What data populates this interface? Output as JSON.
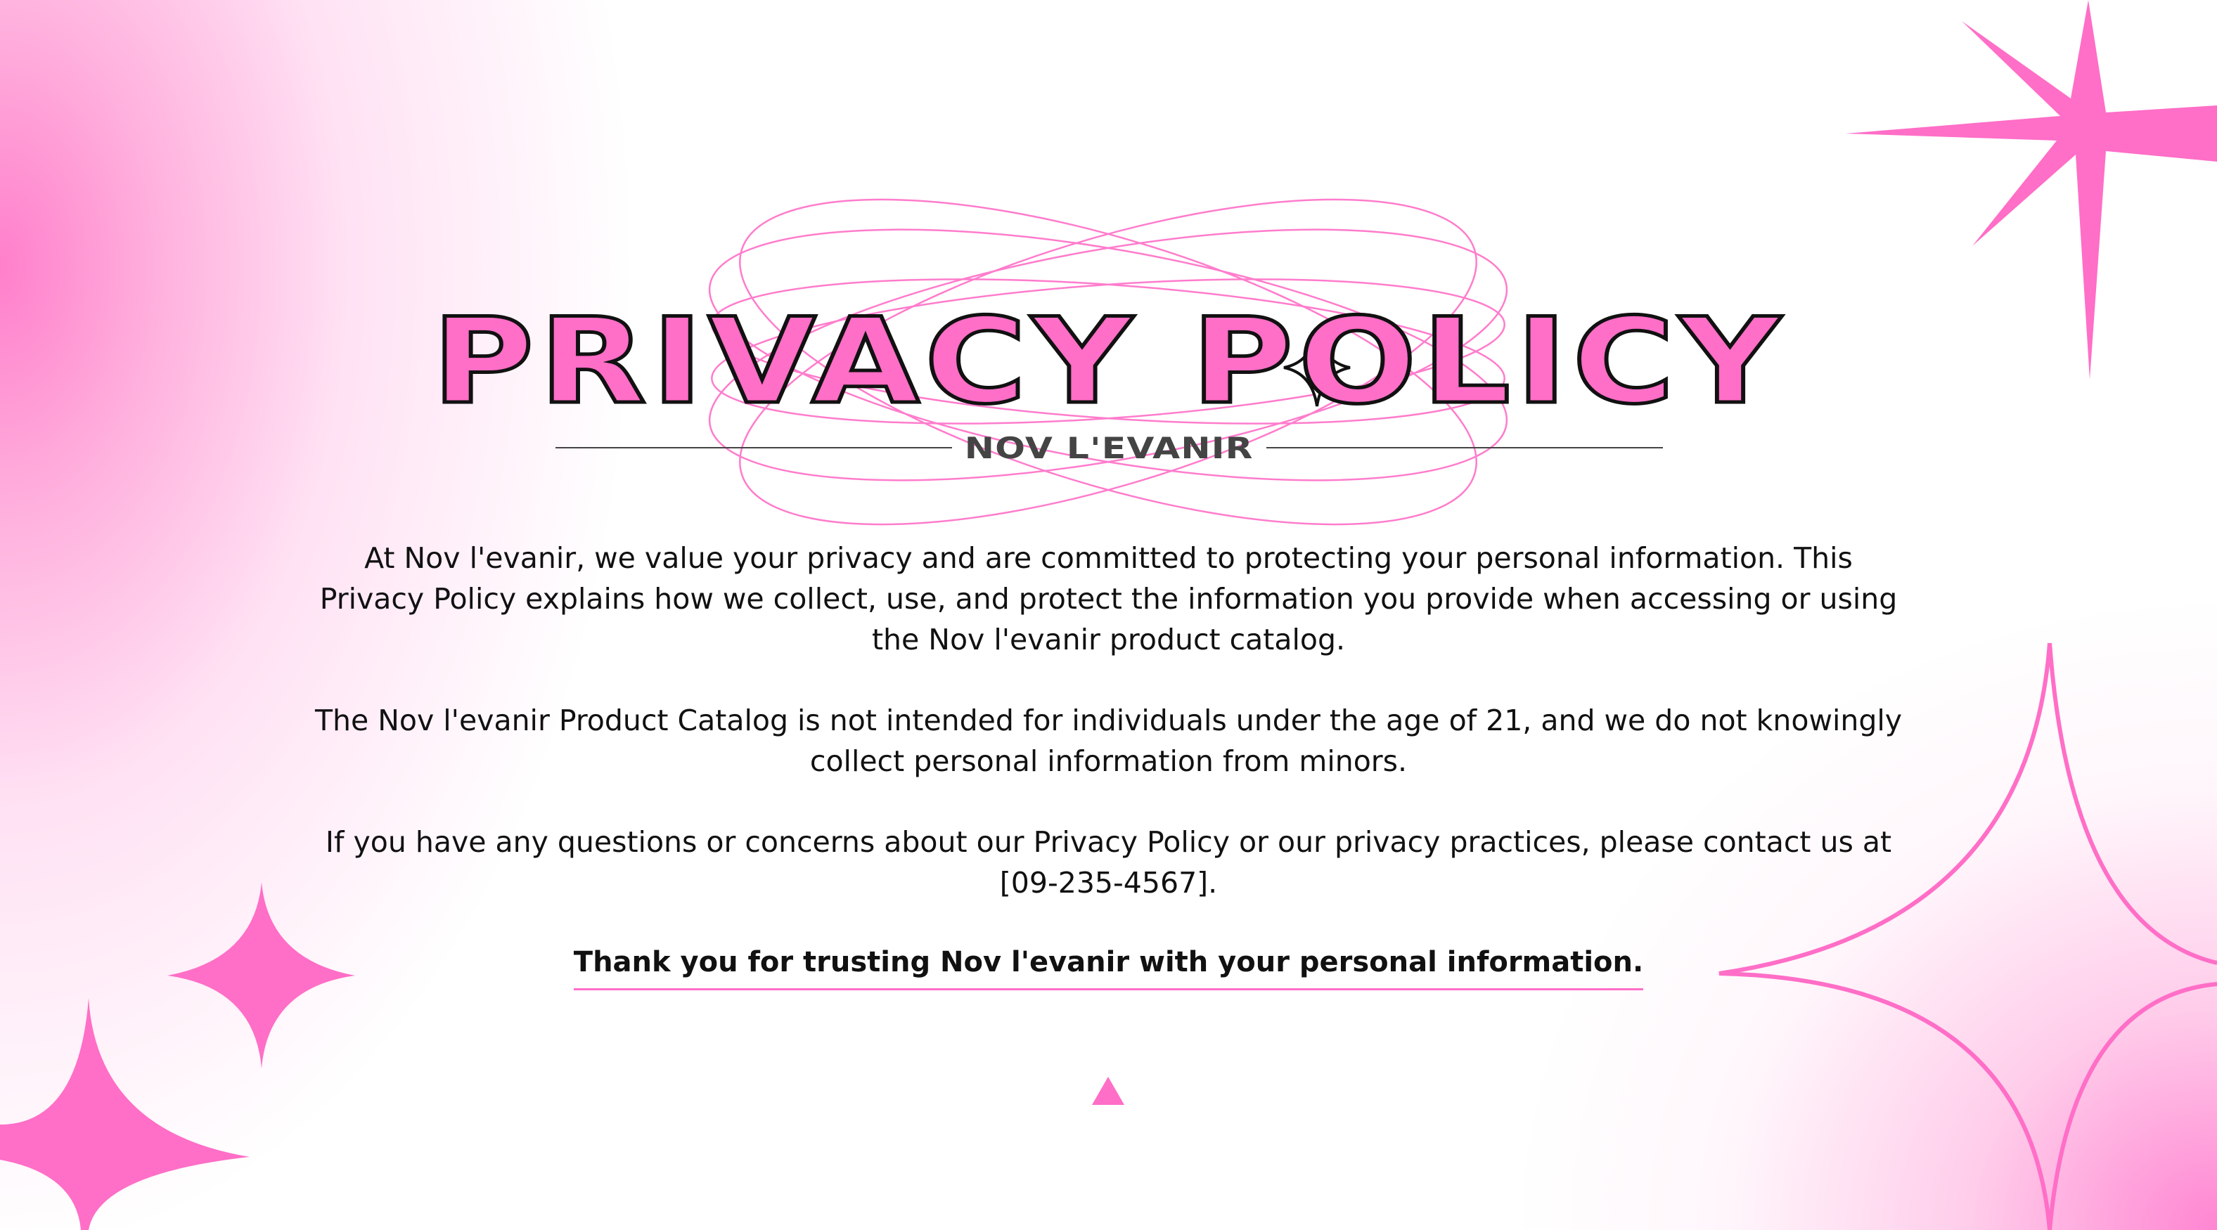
{
  "title": "PRIVACY POLICY",
  "subtitle": "NOV L'EVANIR",
  "paragraphs": [
    "At Nov l'evanir, we value your privacy and are committed to protecting your personal information. This Privacy Policy explains how we collect, use, and protect the information you provide when accessing or using the Nov l'evanir product catalog.",
    "The Nov l'evanir Product Catalog is not intended for individuals under the age of 21, and we do not knowingly collect personal information from minors.",
    "If you have any questions or concerns about our Privacy Policy or our privacy practices, please contact us at [09-235-4567]."
  ],
  "closing": "Thank you for trusting Nov l'evanir with your personal information.",
  "colors": {
    "accent": "#ff6ec7",
    "text": "#111111",
    "rule": "#444444"
  },
  "icons": [
    "sparkle-star-icon",
    "orbit-ellipses-icon",
    "next-triangle-icon"
  ]
}
